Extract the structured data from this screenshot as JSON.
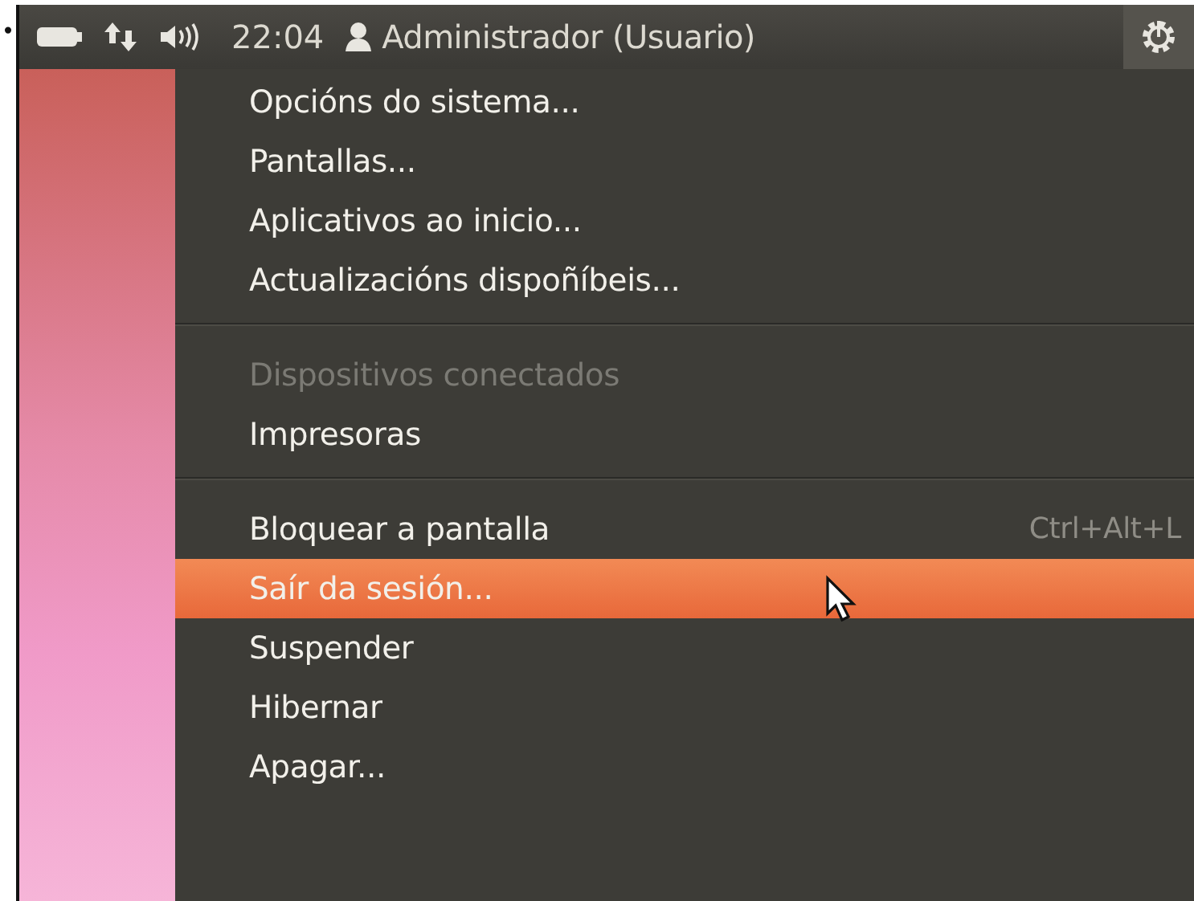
{
  "bullet": "•",
  "panel": {
    "clock": "22:04",
    "user": "Administrador (Usuario)"
  },
  "menu": {
    "sections": [
      {
        "items": [
          {
            "label": "Opcións do sistema...",
            "disabled": false,
            "selected": false
          },
          {
            "label": "Pantallas...",
            "disabled": false,
            "selected": false
          },
          {
            "label": "Aplicativos ao inicio...",
            "disabled": false,
            "selected": false
          },
          {
            "label": "Actualizacións dispoñíbeis...",
            "disabled": false,
            "selected": false
          }
        ]
      },
      {
        "items": [
          {
            "label": "Dispositivos conectados",
            "disabled": true,
            "selected": false
          },
          {
            "label": "Impresoras",
            "disabled": false,
            "selected": false
          }
        ]
      },
      {
        "items": [
          {
            "label": "Bloquear a pantalla",
            "shortcut": "Ctrl+Alt+L",
            "disabled": false,
            "selected": false
          },
          {
            "label": "Saír da sesión...",
            "disabled": false,
            "selected": true
          },
          {
            "label": "Suspender",
            "disabled": false,
            "selected": false
          },
          {
            "label": "Hibernar",
            "disabled": false,
            "selected": false
          },
          {
            "label": "Apagar...",
            "disabled": false,
            "selected": false
          }
        ]
      }
    ]
  }
}
